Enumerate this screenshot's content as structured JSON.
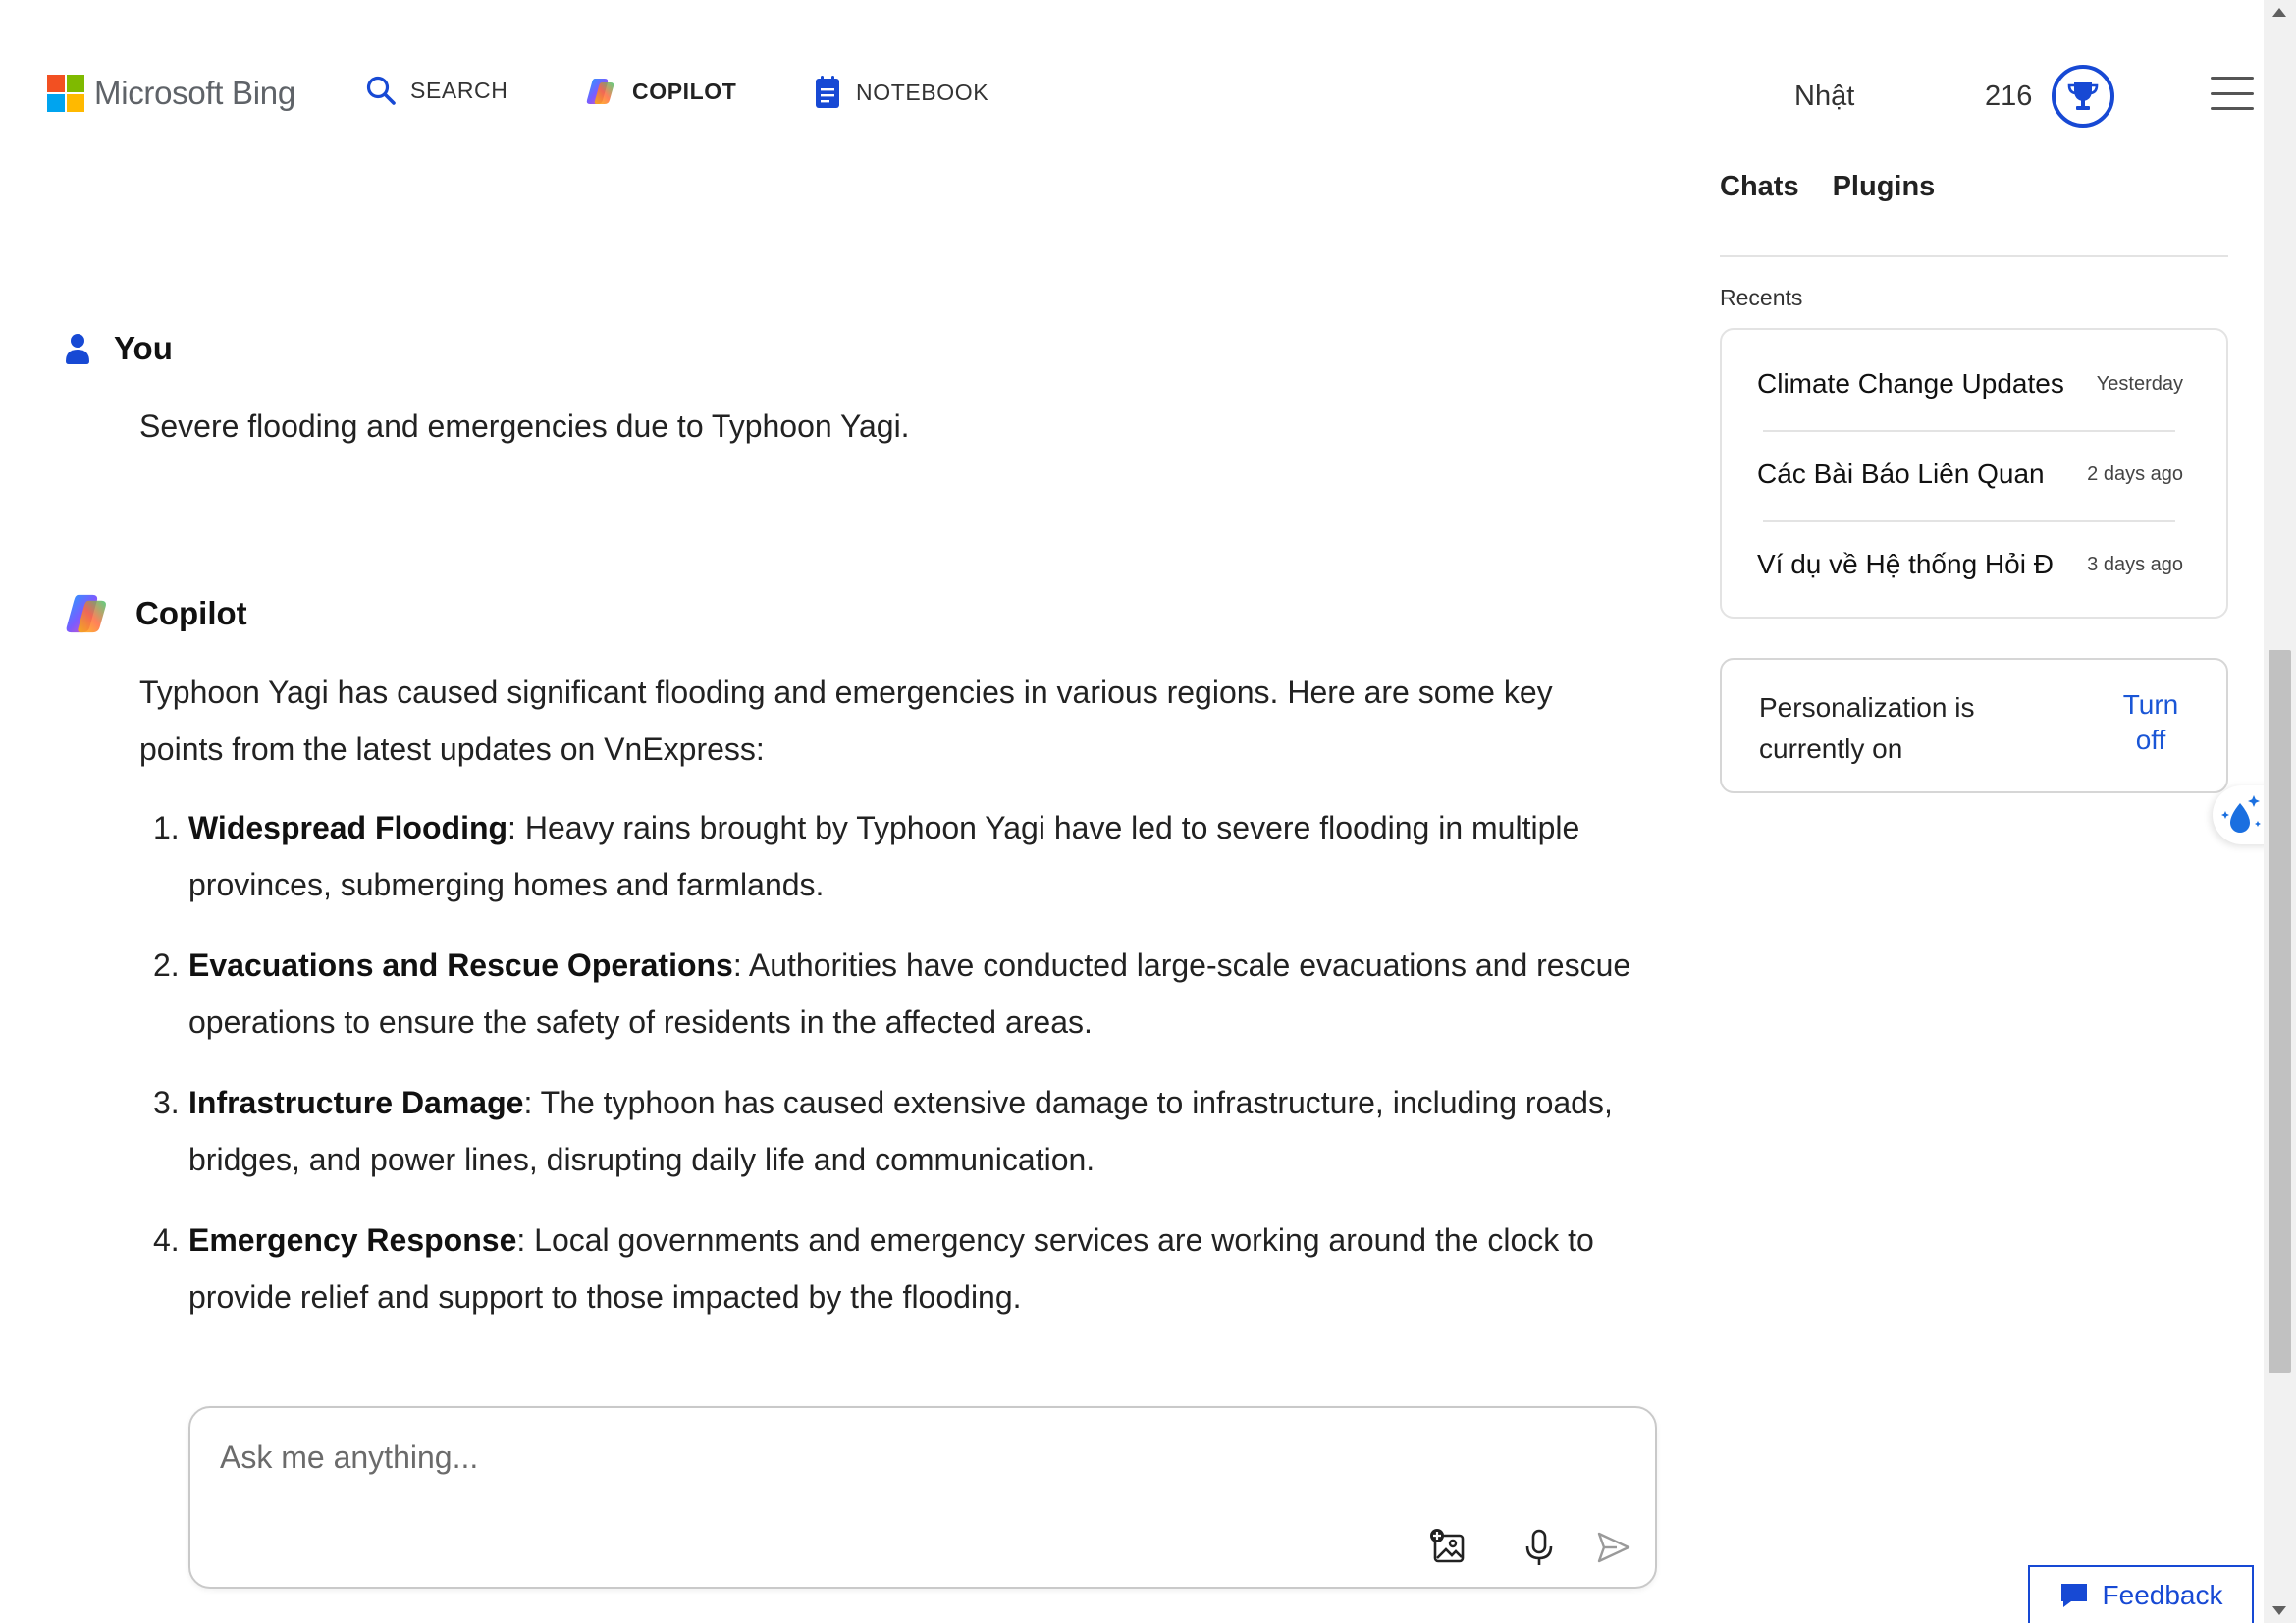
{
  "header": {
    "brand": "Microsoft Bing",
    "nav": [
      {
        "label": "SEARCH",
        "icon": "search-icon"
      },
      {
        "label": "COPILOT",
        "icon": "copilot-icon",
        "active": true
      },
      {
        "label": "NOTEBOOK",
        "icon": "notebook-icon"
      }
    ],
    "user_name": "Nhật",
    "points": "216"
  },
  "chat": {
    "user": {
      "author": "You",
      "message": "Severe flooding and emergencies due to Typhoon Yagi."
    },
    "copilot": {
      "author": "Copilot",
      "intro": "Typhoon Yagi has caused significant flooding and emergencies in various regions. Here are some key points from the latest updates on VnExpress:",
      "points": [
        {
          "num": "1.",
          "title": "Widespread Flooding",
          "text": ": Heavy rains brought by Typhoon Yagi have led to severe flooding in multiple provinces, submerging homes and farmlands."
        },
        {
          "num": "2.",
          "title": "Evacuations and Rescue Operations",
          "text": ": Authorities have conducted large-scale evacuations and rescue operations to ensure the safety of residents in the affected areas."
        },
        {
          "num": "3.",
          "title": "Infrastructure Damage",
          "text": ": The typhoon has caused extensive damage to infrastructure, including roads, bridges, and power lines, disrupting daily life and communication."
        },
        {
          "num": "4.",
          "title": "Emergency Response",
          "text": ": Local governments and emergency services are working around the clock to provide relief and support to those impacted by the flooding."
        }
      ]
    }
  },
  "input": {
    "placeholder": "Ask me anything..."
  },
  "panel": {
    "tabs": [
      "Chats",
      "Plugins"
    ],
    "recents_label": "Recents",
    "recents": [
      {
        "title": "Climate Change Updates",
        "time": "Yesterday"
      },
      {
        "title": "Các Bài Báo Liên Quan",
        "time": "2 days ago"
      },
      {
        "title": "Ví dụ về Hệ thống Hỏi Đ",
        "time": "3 days ago"
      }
    ],
    "personalization": {
      "text": "Personalization is currently on",
      "button_line1": "Turn",
      "button_line2": "off"
    }
  },
  "feedback_label": "Feedback",
  "colors": {
    "accent": "#1749d4",
    "link": "#1a56d6",
    "ms_red": "#f25022",
    "ms_green": "#7fba00",
    "ms_blue": "#00a4ef",
    "ms_yellow": "#ffb900"
  }
}
